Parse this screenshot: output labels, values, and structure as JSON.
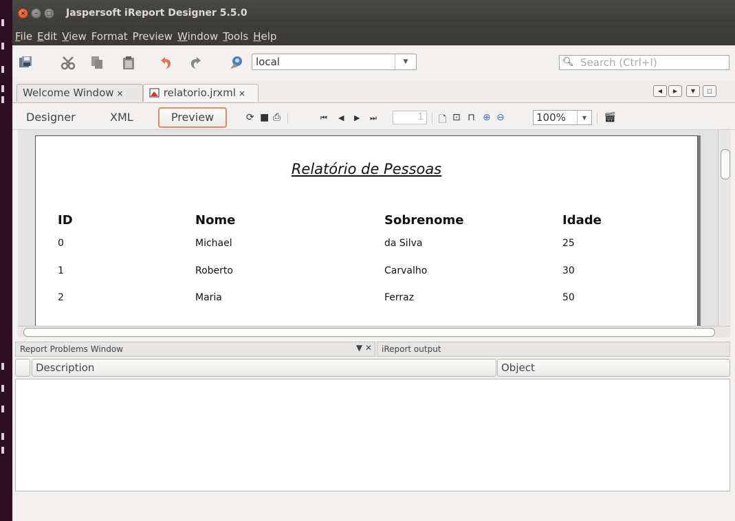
{
  "window": {
    "title": "Jaspersoft iReport Designer 5.5.0",
    "close_glyph": "×",
    "min_glyph": "–",
    "max_glyph": "□"
  },
  "menu": [
    {
      "mnemonic": "F",
      "rest": "ile"
    },
    {
      "mnemonic": "E",
      "rest": "dit"
    },
    {
      "mnemonic": "V",
      "rest": "iew"
    },
    {
      "label": "Format"
    },
    {
      "label": "Preview"
    },
    {
      "mnemonic": "W",
      "rest": "indow"
    },
    {
      "mnemonic": "T",
      "rest": "ools"
    },
    {
      "mnemonic": "H",
      "rest": "elp"
    }
  ],
  "toolbar": {
    "icons": [
      "save-all-icon",
      "cut-icon",
      "copy-icon",
      "paste-icon",
      "undo-icon",
      "redo-icon",
      "datasource-icon"
    ],
    "datasource_value": "local",
    "search_placeholder": "Search (Ctrl+I)"
  },
  "tabs": [
    {
      "label": "Welcome Window",
      "close": "×"
    },
    {
      "label": "relatorio.jrxml",
      "close": "×",
      "active": true
    }
  ],
  "view_tabs": {
    "designer": "Designer",
    "xml": "XML",
    "preview": "Preview"
  },
  "preview_toolbar": {
    "page_number": "1",
    "zoom": "100%"
  },
  "report": {
    "title": "Relatório de Pessoas",
    "columns": [
      "ID",
      "Nome",
      "Sobrenome",
      "Idade"
    ],
    "rows": [
      [
        "0",
        "Michael",
        "da Silva",
        "25"
      ],
      [
        "1",
        "Roberto",
        "Carvalho",
        "30"
      ],
      [
        "2",
        "Maria",
        "Ferraz",
        "50"
      ]
    ]
  },
  "bottom_panel": {
    "problems_tab": "Report Problems Window",
    "output_tab": "iReport output",
    "columns": [
      "Description",
      "Object"
    ]
  },
  "colors": {
    "titlebar": "#3b3a36",
    "close_button": "#dd4814",
    "preview_highlight": "#e08a60"
  }
}
